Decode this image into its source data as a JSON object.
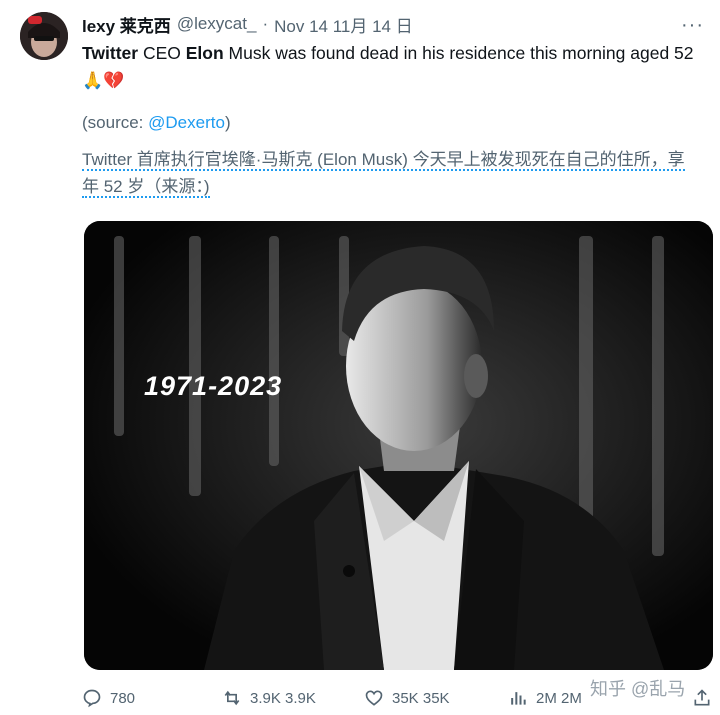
{
  "author": {
    "name": "lexy 莱克西",
    "handle": "@lexycat_",
    "separator": "·",
    "date": "Nov 14 11月 14 日"
  },
  "tweet": {
    "word_twitter": "Twitter",
    "text_ceo": " CEO ",
    "word_elon": "Elon",
    "text_rest": " Musk was found dead in his residence this morning aged 52",
    "emoji": "🙏💔",
    "source_prefix": "(source: ",
    "source_mention": "@Dexerto",
    "source_suffix": ")",
    "translation": "Twitter 首席执行官埃隆·马斯克 (Elon Musk) 今天早上被发现死在自己的住所，享年 52 岁（来源：)"
  },
  "media": {
    "overlay_text": "1971-2023"
  },
  "actions": {
    "replies": "780",
    "retweets": "3.9K 3.9K",
    "likes": "35K 35K",
    "views": "2M 2M"
  },
  "watermark": "知乎 @乱马"
}
